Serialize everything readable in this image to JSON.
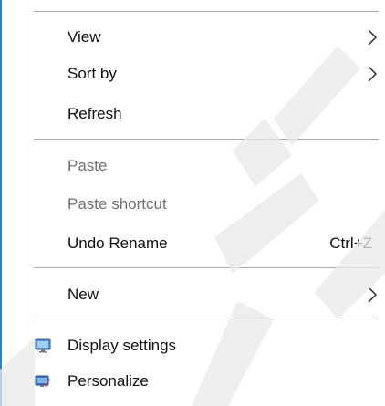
{
  "menu": {
    "items": [
      {
        "label": "View",
        "submenu": true,
        "enabled": true
      },
      {
        "label": "Sort by",
        "submenu": true,
        "enabled": true
      },
      {
        "label": "Refresh",
        "enabled": true
      },
      {
        "label": "Paste",
        "enabled": false
      },
      {
        "label": "Paste shortcut",
        "enabled": false
      },
      {
        "label": "Undo Rename",
        "shortcut": "Ctrl+Z",
        "enabled": true
      },
      {
        "label": "New",
        "submenu": true,
        "enabled": true
      },
      {
        "label": "Display settings",
        "icon": "display-settings-icon",
        "enabled": true
      },
      {
        "label": "Personalize",
        "icon": "personalize-icon",
        "enabled": true
      }
    ]
  },
  "colors": {
    "accent_edge": "#2f80c9",
    "separator": "#a9a9a9",
    "text": "#111111",
    "disabled_text": "#707070",
    "watermark": "#ececec"
  }
}
